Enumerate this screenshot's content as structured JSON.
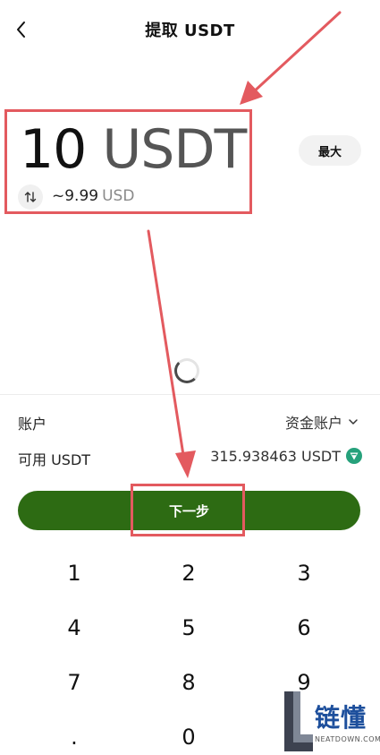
{
  "header": {
    "title": "提取 USDT",
    "back_icon": "back-arrow-icon"
  },
  "amount": {
    "value": "10",
    "unit": "USDT",
    "fiat_value": "~9.99",
    "fiat_unit": "USD",
    "swap_icon": "swap-vertical-icon"
  },
  "max_button": {
    "label": "最大"
  },
  "account": {
    "label": "账户",
    "value": "资金账户",
    "dropdown_icon": "chevron-down-icon"
  },
  "available": {
    "label": "可用 USDT",
    "value": "315.938463 USDT",
    "icon": "tether-icon"
  },
  "next_button": {
    "label": "下一步"
  },
  "keypad": {
    "keys": [
      "1",
      "2",
      "3",
      "4",
      "5",
      "6",
      "7",
      "8",
      "9",
      ".",
      "0"
    ]
  },
  "watermark": {
    "text": "链懂",
    "sub": "NEATDOWN.COM"
  },
  "colors": {
    "accent_green": "#2d6b13",
    "annotation_red": "#e35a5f",
    "tether_teal": "#26a17b",
    "watermark_blue": "#1d4f9c"
  }
}
